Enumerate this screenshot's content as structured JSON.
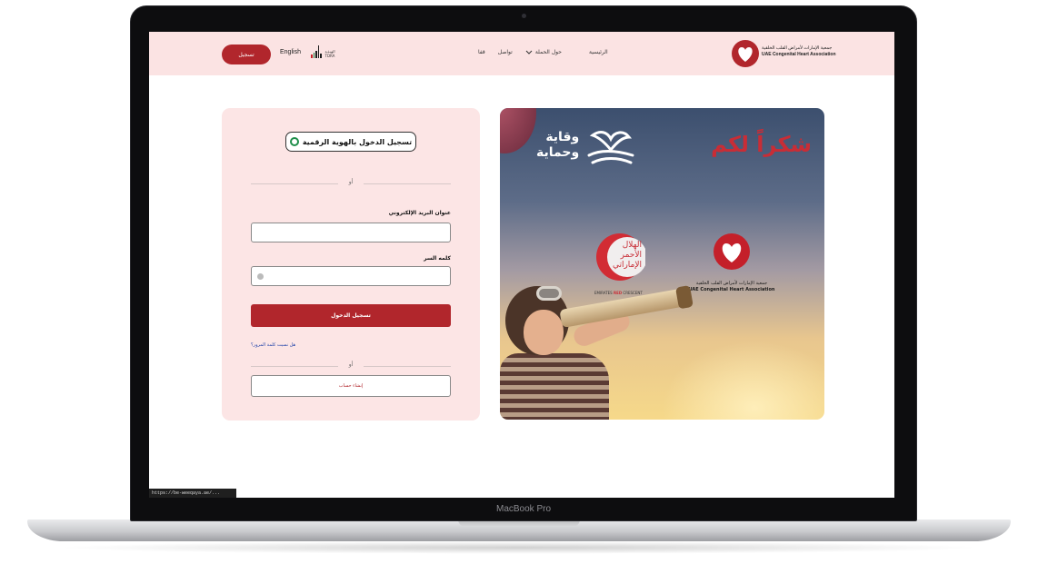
{
  "laptop": {
    "brand_label": "MacBook Pro"
  },
  "header": {
    "login_button": "تسجيل",
    "language": "English",
    "tdra_logo_text": [
      "الهيـئـة",
      "TDRA"
    ],
    "nav": [
      {
        "label": "حول الحملة"
      },
      {
        "label": "تواصل"
      },
      {
        "label": "قفا"
      }
    ],
    "home": "الرئيسية",
    "org_name_ar": "جمعية الإمارات لأمراض القلب الخلقية",
    "org_name_en": "UAE Congenital Heart Association"
  },
  "login": {
    "uae_pass_button": "تسجيل الدخول بالهوية الرقمية",
    "or_label": "أو",
    "email_label": "عنوان البريد الإلكتروني",
    "email_value": "",
    "password_label": "كلمه السر",
    "password_value": "",
    "submit_button": "تسجيل الدخول",
    "forgot_link": "هل نسيت كلمة المرور؟",
    "or_label_2": "أو",
    "create_account_button": "إنشاء حساب"
  },
  "banner": {
    "thanks_text": "شكراً لكم",
    "campaign_line1": "وقاية",
    "campaign_line2": "وحماية",
    "red_crescent_ar": [
      "الهلال",
      "الأحمر",
      "الإماراتي"
    ],
    "red_crescent_en_1": "EMIRATES",
    "red_crescent_en_2": "RED",
    "red_crescent_en_3": "CRESCENT",
    "assoc_ar": "جمعية الإمارات لأمراض القلب الخلقية",
    "assoc_en": "UAE Congenital Heart Association"
  },
  "status_bar": {
    "url": "https://be-weeqaya.ae/..."
  },
  "colors": {
    "brand_red": "#b1262c",
    "header_bg": "#fbe3e3",
    "card_bg": "#fce5e5"
  }
}
